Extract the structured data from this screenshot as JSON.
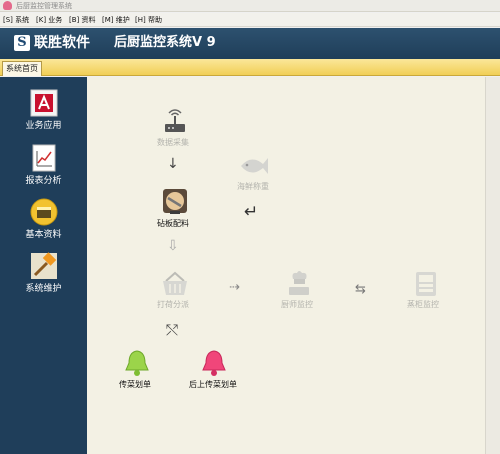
{
  "window": {
    "title": "后厨监控管理系统"
  },
  "menu": [
    {
      "label": "[S] 系统"
    },
    {
      "label": "[K] 业务"
    },
    {
      "label": "[B] 资料"
    },
    {
      "label": "[M] 维护"
    },
    {
      "label": "[H] 帮助"
    }
  ],
  "banner": {
    "logo_letter": "S",
    "brand": "联胜软件",
    "system": "后厨监控系统V 9"
  },
  "tabs": [
    {
      "label": "系统首页"
    }
  ],
  "sidebar": {
    "items": [
      {
        "label": "业务应用",
        "icon": "business-app-icon"
      },
      {
        "label": "报表分析",
        "icon": "report-chart-icon"
      },
      {
        "label": "基本资料",
        "icon": "data-folder-icon"
      },
      {
        "label": "系统维护",
        "icon": "maintenance-hammer-icon"
      }
    ]
  },
  "flow": {
    "data_collect": "数据采集",
    "seafood_weigh": "海鲜称重",
    "board_allocate": "砧板配料",
    "dispatch": "打荷分派",
    "chef_monitor": "厨师监控",
    "steamer_monitor": "蒸柜监控",
    "serve_order": "传菜划单",
    "after_serve_order": "后上传菜划单"
  },
  "colors": {
    "banner": "#244766",
    "sidebar": "#1f3e5a",
    "tab_strip": "#f1cf56",
    "canvas": "#f3f1e4",
    "bell_green": "#9bd44a",
    "bell_pink": "#f0467a"
  }
}
